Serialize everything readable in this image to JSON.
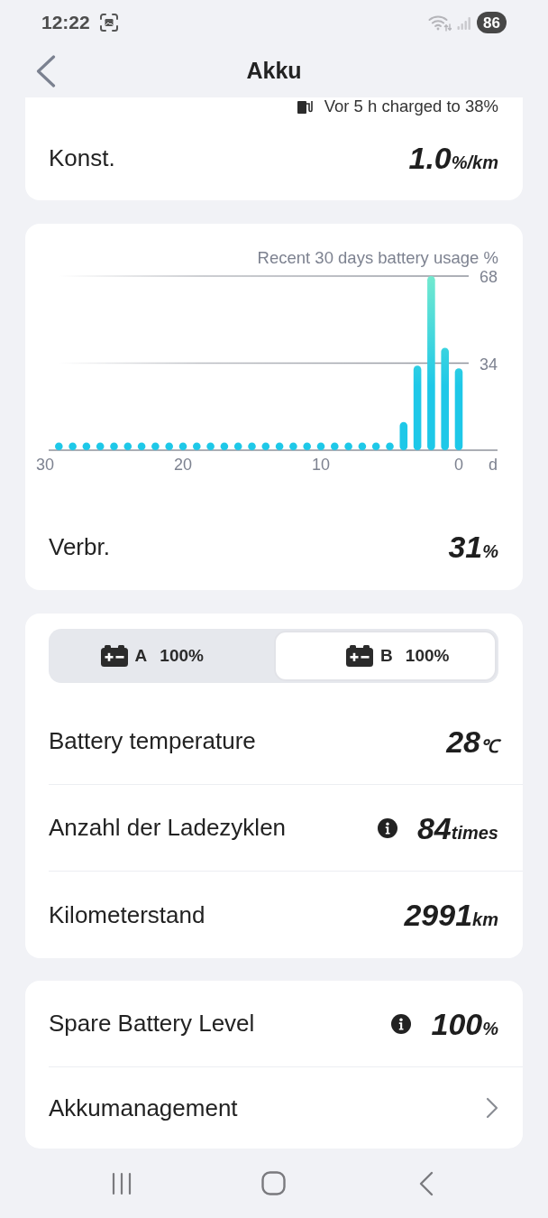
{
  "status_bar": {
    "time": "12:22",
    "battery": "86"
  },
  "header": {
    "title": "Akku"
  },
  "consumption_card": {
    "note": "Vor 5 h charged to 38%",
    "label": "Konst.",
    "value": "1.0",
    "unit": "%/km"
  },
  "usage_card": {
    "chart_data": {
      "type": "bar",
      "title": "Recent 30 days battery usage %",
      "xlabel": "d",
      "x": [
        29,
        28,
        27,
        26,
        25,
        24,
        23,
        22,
        21,
        20,
        19,
        18,
        17,
        16,
        15,
        14,
        13,
        12,
        11,
        10,
        9,
        8,
        7,
        6,
        5,
        4,
        3,
        2,
        1,
        0
      ],
      "values": [
        3,
        3,
        3,
        3,
        3,
        3,
        3,
        3,
        3,
        3,
        3,
        3,
        3,
        3,
        3,
        3,
        3,
        3,
        3,
        3,
        3,
        3,
        3,
        3,
        3,
        11,
        33,
        68,
        40,
        32
      ],
      "xlim": [
        30,
        0
      ],
      "ylim": [
        0,
        68
      ],
      "xticks": [
        30,
        20,
        10,
        0
      ],
      "yticks": [
        34,
        68
      ]
    },
    "label": "Verbr.",
    "value": "31",
    "unit": "%"
  },
  "battery_tabs": [
    {
      "label": "A",
      "charge": "100%",
      "selected": false
    },
    {
      "label": "B",
      "charge": "100%",
      "selected": true
    }
  ],
  "battery_stats": [
    {
      "label": "Battery temperature",
      "value": "28",
      "unit": "℃",
      "info": false
    },
    {
      "label": "Anzahl der Ladezyklen",
      "value": "84",
      "unit": "times",
      "info": true
    },
    {
      "label": "Kilometerstand",
      "value": "2991",
      "unit": "km",
      "info": false
    }
  ],
  "bottom_card": {
    "rows": [
      {
        "kind": "stat",
        "label": "Spare Battery Level",
        "value": "100",
        "unit": "%",
        "info": true
      },
      {
        "kind": "link",
        "label": "Akkumanagement"
      }
    ]
  }
}
